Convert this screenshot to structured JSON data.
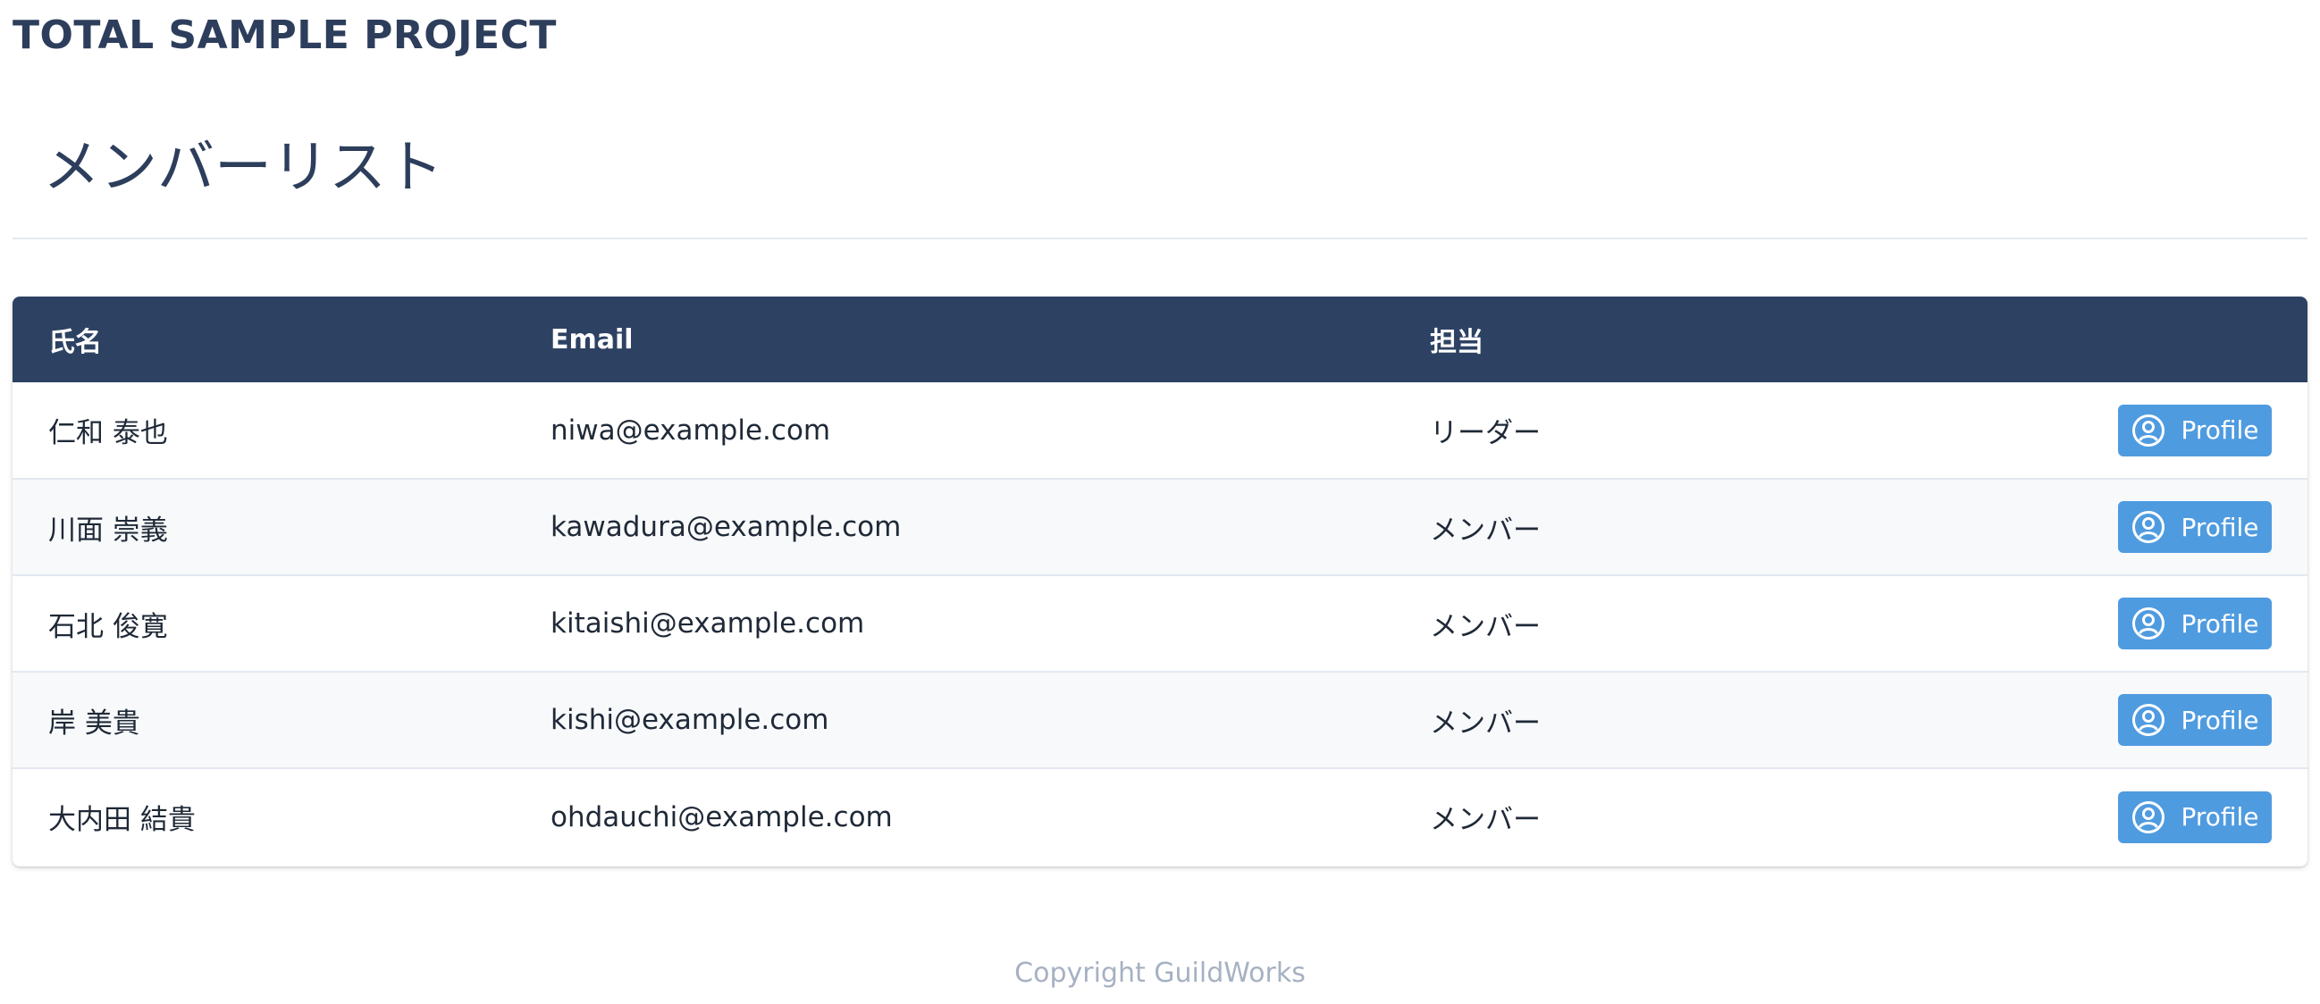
{
  "app": {
    "title": "TOTAL SAMPLE PROJECT"
  },
  "page": {
    "title": "メンバーリスト"
  },
  "table": {
    "headers": {
      "name": "氏名",
      "email": "Email",
      "role": "担当",
      "action": ""
    },
    "rows": [
      {
        "name": "仁和 泰也",
        "email": "niwa@example.com",
        "role": "リーダー",
        "action_label": "Profile"
      },
      {
        "name": "川面 崇義",
        "email": "kawadura@example.com",
        "role": "メンバー",
        "action_label": "Profile"
      },
      {
        "name": "石北 俊寛",
        "email": "kitaishi@example.com",
        "role": "メンバー",
        "action_label": "Profile"
      },
      {
        "name": "岸 美貴",
        "email": "kishi@example.com",
        "role": "メンバー",
        "action_label": "Profile"
      },
      {
        "name": "大内田 結貴",
        "email": "ohdauchi@example.com",
        "role": "メンバー",
        "action_label": "Profile"
      }
    ],
    "action_icon": "user-circle-icon"
  },
  "footer": {
    "copyright": "Copyright GuildWorks"
  },
  "colors": {
    "header_bg": "#2d4263",
    "title_text": "#2d3e5c",
    "button_bg": "#4f9be0",
    "footer_text": "#a6b1c2",
    "stripe_bg": "#f7f9fb"
  }
}
